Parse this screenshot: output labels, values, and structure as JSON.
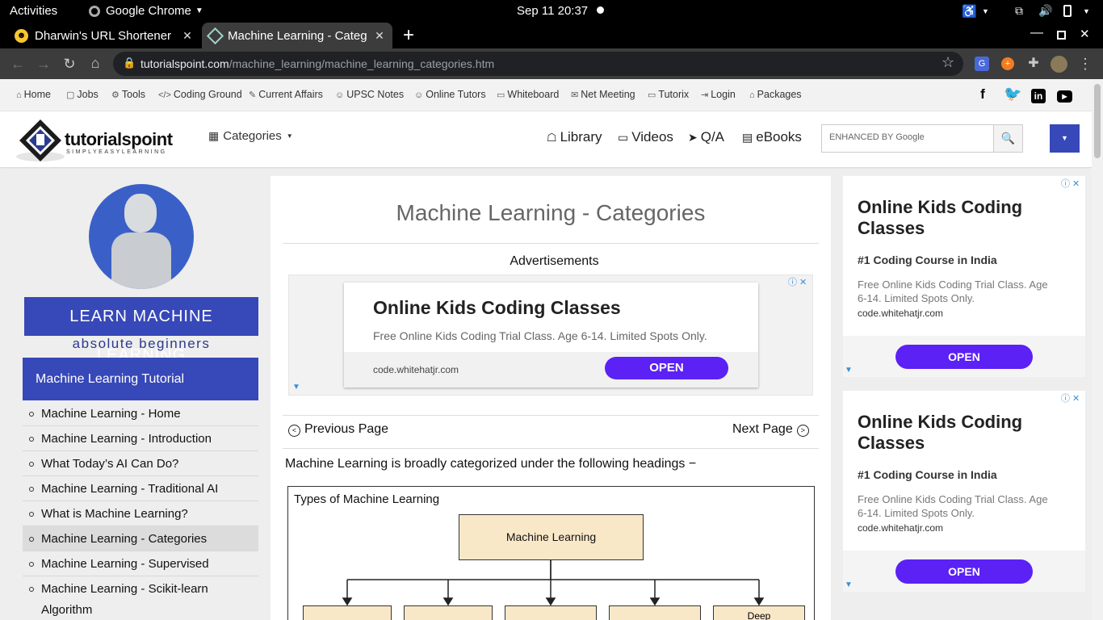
{
  "os_bar": {
    "activities": "Activities",
    "app": "Google Chrome",
    "datetime": "Sep 11  20:37"
  },
  "tabs": [
    {
      "title": "Dharwin's URL Shortener",
      "icon": "smiley-icon",
      "active": false
    },
    {
      "title": "Machine Learning - Categ",
      "icon": "tutorialspoint-icon",
      "active": true
    }
  ],
  "new_tab_label": "+",
  "address": {
    "domain": "tutorialspoint.com",
    "path": "/machine_learning/machine_learning_categories.htm"
  },
  "site_links": [
    "Home",
    "Jobs",
    "Tools",
    "Coding Ground",
    "Current Affairs",
    "UPSC Notes",
    "Online Tutors",
    "Whiteboard",
    "Net Meeting",
    "Tutorix",
    "Login",
    "Packages"
  ],
  "social": [
    "f",
    "t",
    "in",
    "yt"
  ],
  "logo": {
    "name": "tutorialspoint",
    "tagline": "SIMPLYEASYLEARNING"
  },
  "header": {
    "categories": "Categories",
    "nav": [
      "Library",
      "Videos",
      "Q/A",
      "eBooks"
    ],
    "search_placeholder": "ENHANCED BY Google"
  },
  "sidebar": {
    "banner_line1": "LEARN MACHINE LEARNING",
    "banner_line2": "absolute beginners",
    "tutorial_title": "Machine Learning Tutorial",
    "items": [
      "Machine Learning - Home",
      "Machine Learning - Introduction",
      "What Today’s AI Can Do?",
      "Machine Learning - Traditional AI",
      "What is Machine Learning?",
      "Machine Learning - Categories",
      "Machine Learning - Supervised",
      "Machine Learning - Scikit-learn",
      "Algorithm"
    ],
    "selected_index": 5
  },
  "main": {
    "title": "Machine Learning - Categories",
    "ads_label": "Advertisements",
    "ad": {
      "headline": "Online Kids Coding Classes",
      "body": "Free Online Kids Coding Trial Class. Age 6-14. Limited Spots Only.",
      "url": "code.whitehatjr.com",
      "cta": "OPEN"
    },
    "prev": "Previous Page",
    "next": "Next Page",
    "intro": "Machine Learning is broadly categorized under the following headings −",
    "diagram": {
      "title": "Types of Machine Learning",
      "root": "Machine Learning",
      "child_last": "Deep"
    }
  },
  "right_ads": [
    {
      "headline_l1": "Online Kids Coding",
      "headline_l2": "Classes",
      "sub": "#1 Coding Course in India",
      "body_l1": "Free Online Kids Coding Trial Class. Age",
      "body_l2": "6-14. Limited Spots Only.",
      "url": "code.whitehatjr.com",
      "cta": "OPEN"
    },
    {
      "headline_l1": "Online Kids Coding",
      "headline_l2": "Classes",
      "sub": "#1 Coding Course in India",
      "body_l1": "Free Online Kids Coding Trial Class. Age",
      "body_l2": "6-14. Limited Spots Only.",
      "url": "code.whitehatjr.com",
      "cta": "OPEN"
    }
  ],
  "colors": {
    "brand_blue": "#3748b8",
    "open_button": "#5b21f5",
    "node_fill": "#f9e8c8"
  }
}
